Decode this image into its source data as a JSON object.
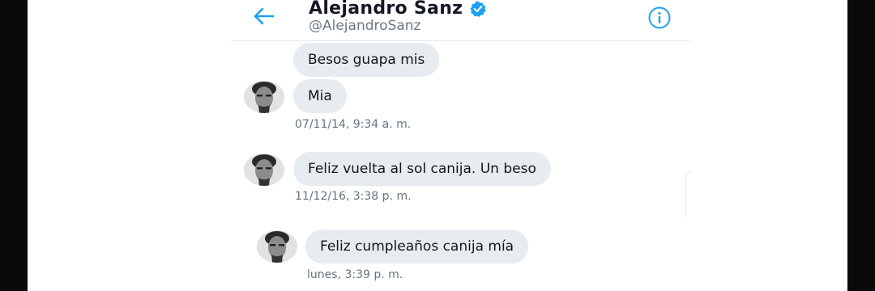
{
  "colors": {
    "accent": "#1da1f2",
    "bubble": "#e6ecf0",
    "timestamp": "#66757f",
    "edge": "#0a0a0a"
  },
  "header": {
    "name": "Alejandro Sanz",
    "handle": "@AlejandroSanz",
    "back_icon": "arrow-left-icon",
    "verified_icon": "verified-badge-icon",
    "info_icon": "info-circle-icon"
  },
  "messages": [
    {
      "text": "Besos guapa mis"
    },
    {
      "text": "Mia"
    },
    {
      "timestamp": "07/11/14, 9:34 a. m."
    },
    {
      "text": "Feliz vuelta al sol canija. Un beso"
    },
    {
      "timestamp": "11/12/16, 3:38 p. m."
    },
    {
      "text": "Feliz cumpleaños canija mía"
    },
    {
      "timestamp": "lunes, 3:39 p. m."
    }
  ]
}
